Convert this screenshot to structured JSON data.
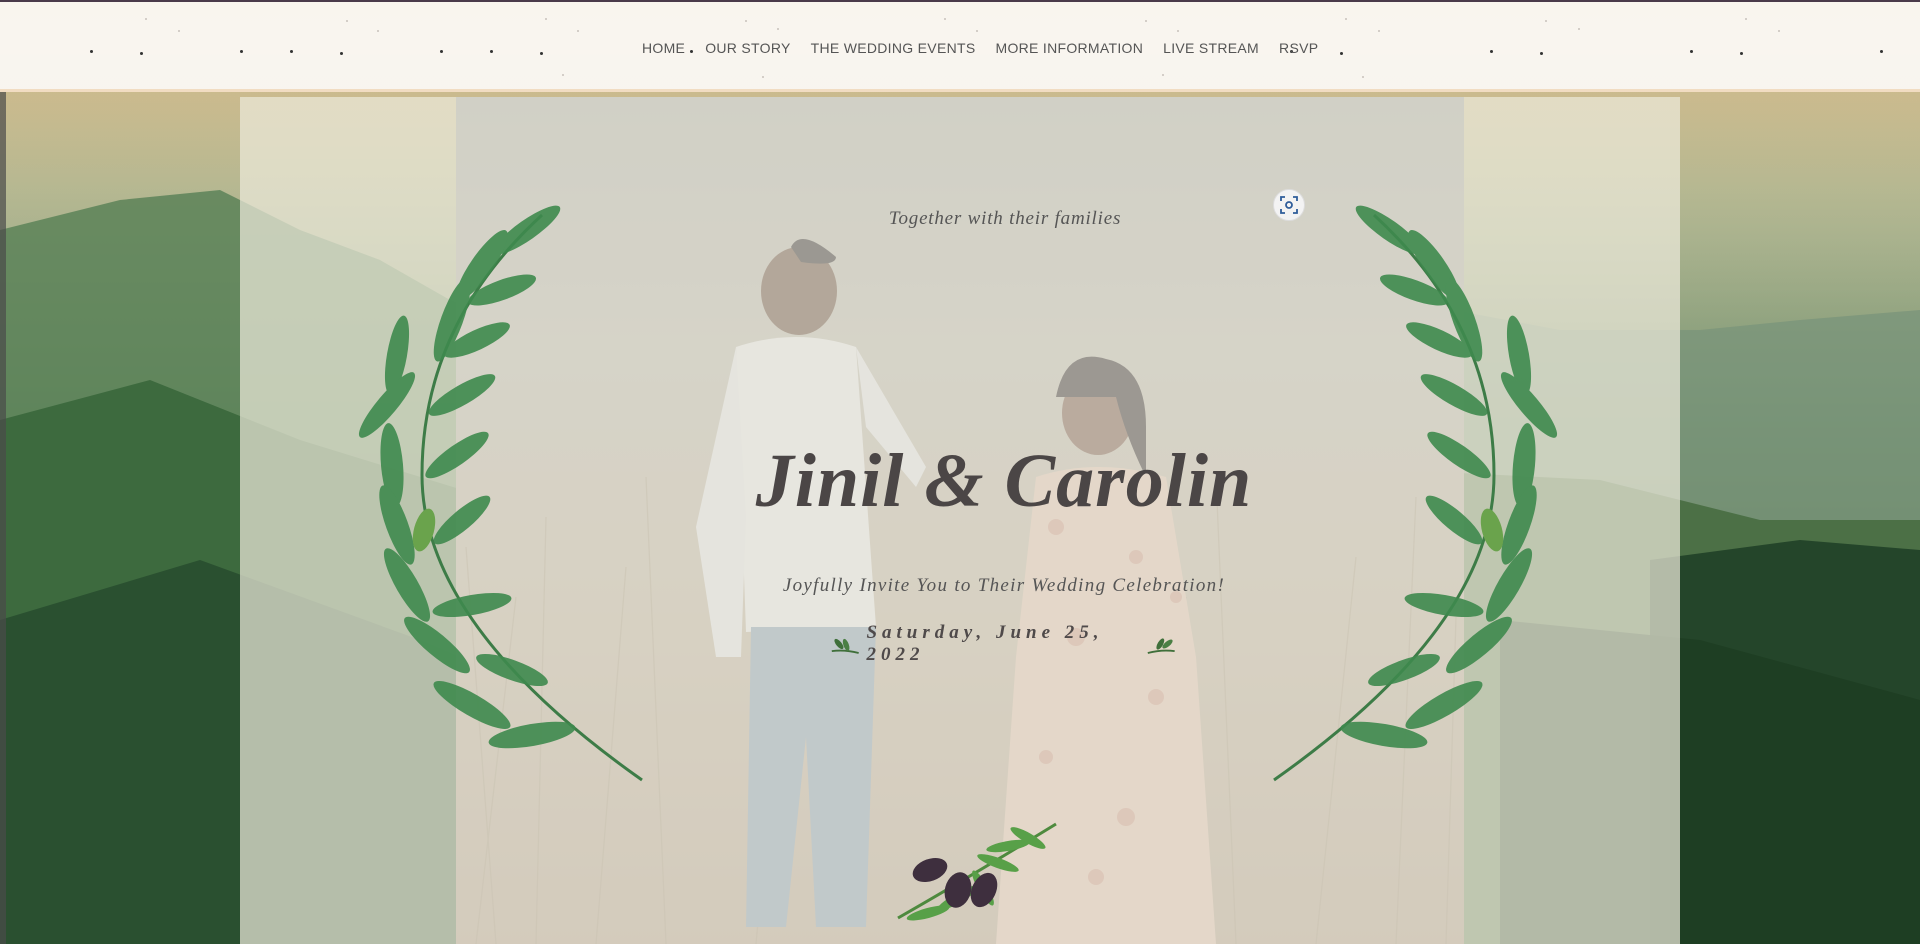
{
  "nav": {
    "items": [
      {
        "label": "HOME"
      },
      {
        "label": "OUR STORY"
      },
      {
        "label": "THE WEDDING EVENTS"
      },
      {
        "label": "MORE INFORMATION"
      },
      {
        "label": "LIVE STREAM"
      },
      {
        "label": "RSVP"
      }
    ]
  },
  "hero": {
    "tagline": "Together with their families",
    "names": "Jinil & Carolin",
    "invitation": "Joyfully Invite You to Their Wedding Celebration!",
    "date": "Saturday, June 25, 2022"
  },
  "colors": {
    "nav_bg": "#faf7f3",
    "text": "#4b4646",
    "laurel": "#3f8a4e",
    "olive": "#4a3a4a"
  },
  "icons": {
    "scan": "visual-search-icon",
    "laurel": "laurel-wreath-icon",
    "olive": "olive-branch-icon"
  }
}
